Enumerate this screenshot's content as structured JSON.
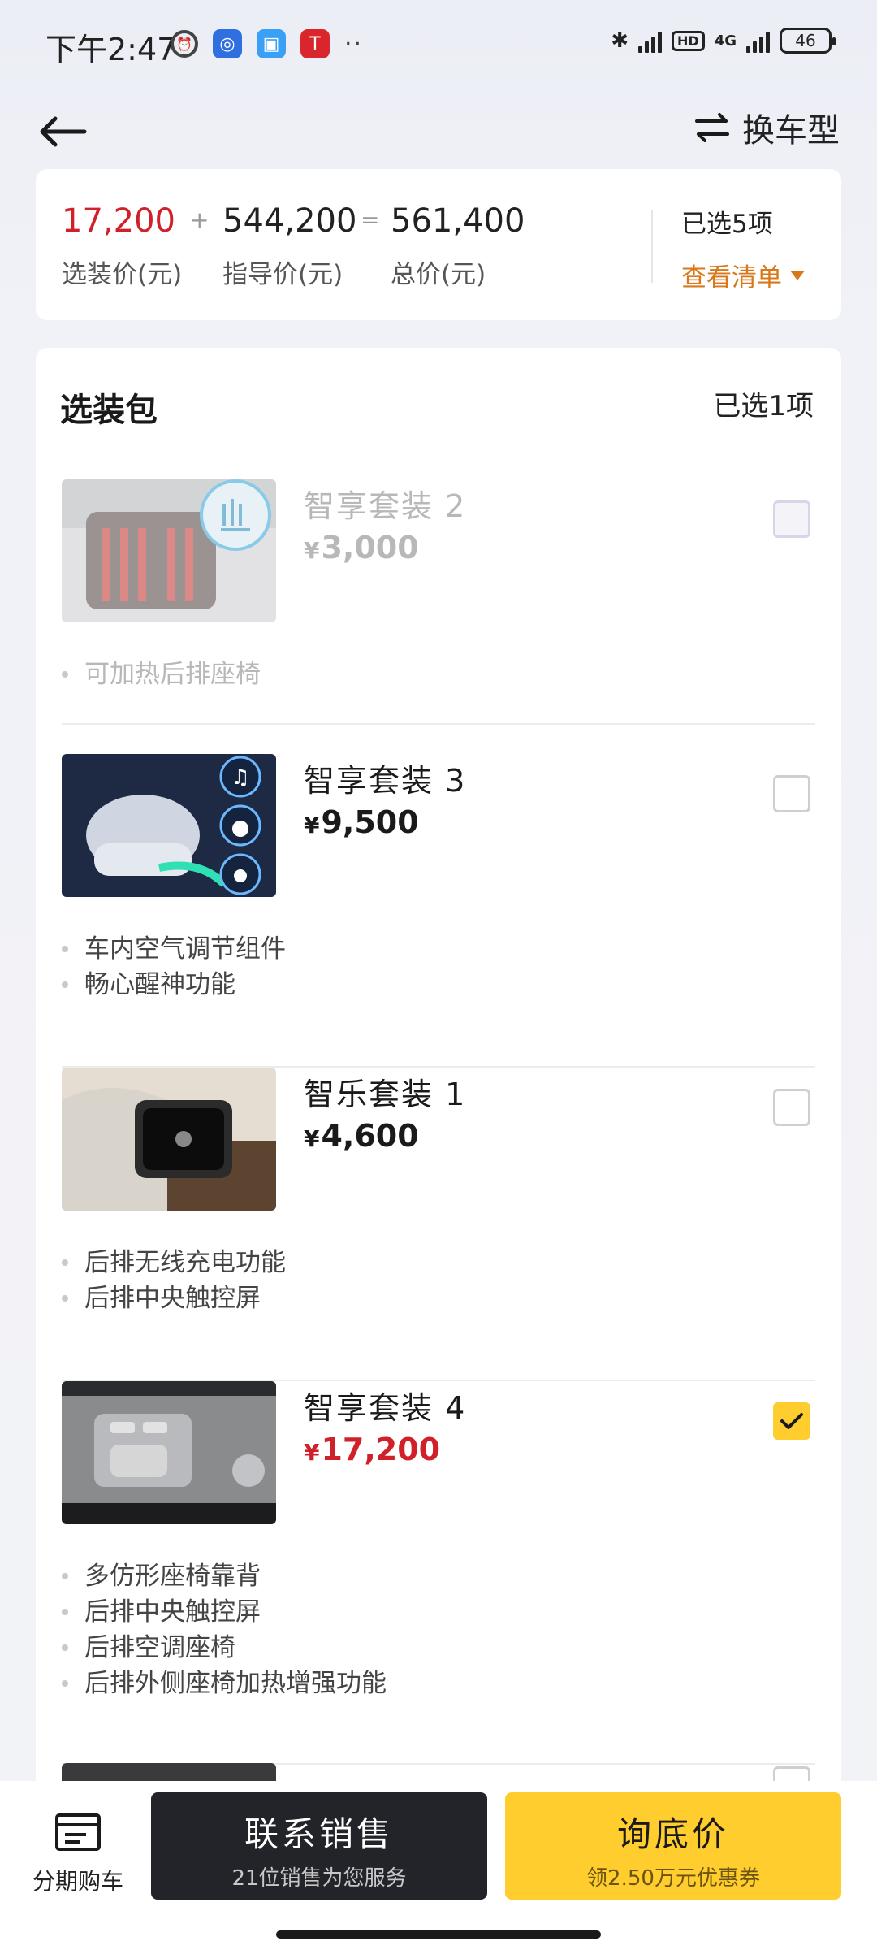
{
  "status": {
    "time": "下午2:47",
    "battery": "46",
    "network": "4G",
    "hd": "HD"
  },
  "nav": {
    "switch_label": "换车型"
  },
  "summary": {
    "option_price": "17,200",
    "option_label": "选装价(元)",
    "plus": "+",
    "guide_price": "544,200",
    "guide_label": "指导价(元)",
    "equals": "=",
    "total_price": "561,400",
    "total_label": "总价(元)",
    "selected_count": "已选5项",
    "view_list": "查看清单",
    "accent_color": "#d9781a",
    "price_color": "#d0212a"
  },
  "packages": {
    "title": "选装包",
    "selected_count": "已选1项",
    "items": [
      {
        "name": "智享套装 2",
        "currency": "¥",
        "price": "3,000",
        "features": [
          "可加热后排座椅"
        ],
        "checked": false,
        "disabled": true
      },
      {
        "name": "智享套装 3",
        "currency": "¥",
        "price": "9,500",
        "features": [
          "车内空气调节组件",
          "畅心醒神功能"
        ],
        "checked": false,
        "disabled": false
      },
      {
        "name": "智乐套装 1",
        "currency": "¥",
        "price": "4,600",
        "features": [
          "后排无线充电功能",
          "后排中央触控屏"
        ],
        "checked": false,
        "disabled": false
      },
      {
        "name": "智享套装 4",
        "currency": "¥",
        "price": "17,200",
        "features": [
          "多仿形座椅靠背",
          "后排中央触控屏",
          "后排空调座椅",
          "后排外侧座椅加热增强功能"
        ],
        "checked": true,
        "disabled": false
      }
    ]
  },
  "bottom": {
    "installment_label": "分期购车",
    "contact_title": "联系销售",
    "contact_sub": "21位销售为您服务",
    "inquiry_title": "询底价",
    "inquiry_sub": "领2.50万元优惠券",
    "cta_color": "#ffcd2e"
  }
}
